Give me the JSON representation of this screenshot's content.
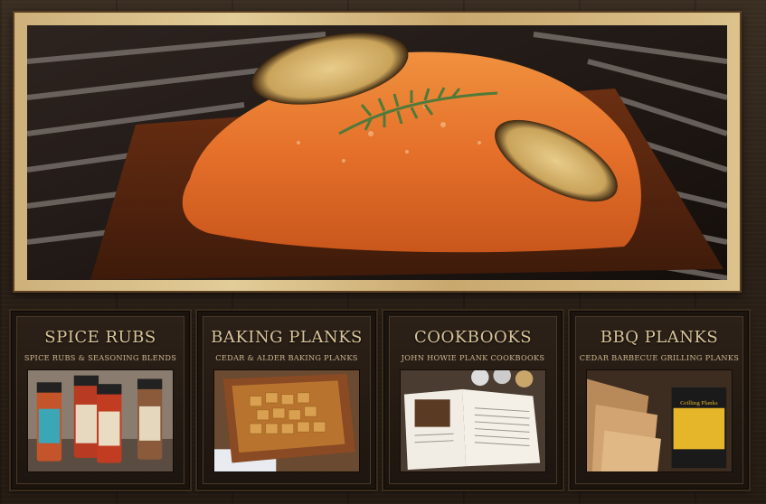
{
  "hero": {
    "image": "cedar-plank-salmon"
  },
  "cards": [
    {
      "title": "SPICE RUBS",
      "subtitle": "SPICE RUBS & SEASONING BLENDS",
      "image": "spice-jars"
    },
    {
      "title": "BAKING PLANKS",
      "subtitle": "CEDAR & ALDER BAKING PLANKS",
      "image": "baking-plank-croutons"
    },
    {
      "title": "COOKBOOKS",
      "subtitle": "JOHN HOWIE PLANK COOKBOOKS",
      "image": "open-cookbook"
    },
    {
      "title": "BBQ PLANKS",
      "subtitle": "CEDAR BARBECUE GRILLING PLANKS",
      "image": "grilling-planks-package"
    }
  ],
  "package": {
    "title": "Grilling Planks"
  },
  "colors": {
    "background": "#2a2017",
    "title_text": "#d9c49a",
    "frame": "#d8bf8a",
    "salmon": "#e2702a"
  }
}
